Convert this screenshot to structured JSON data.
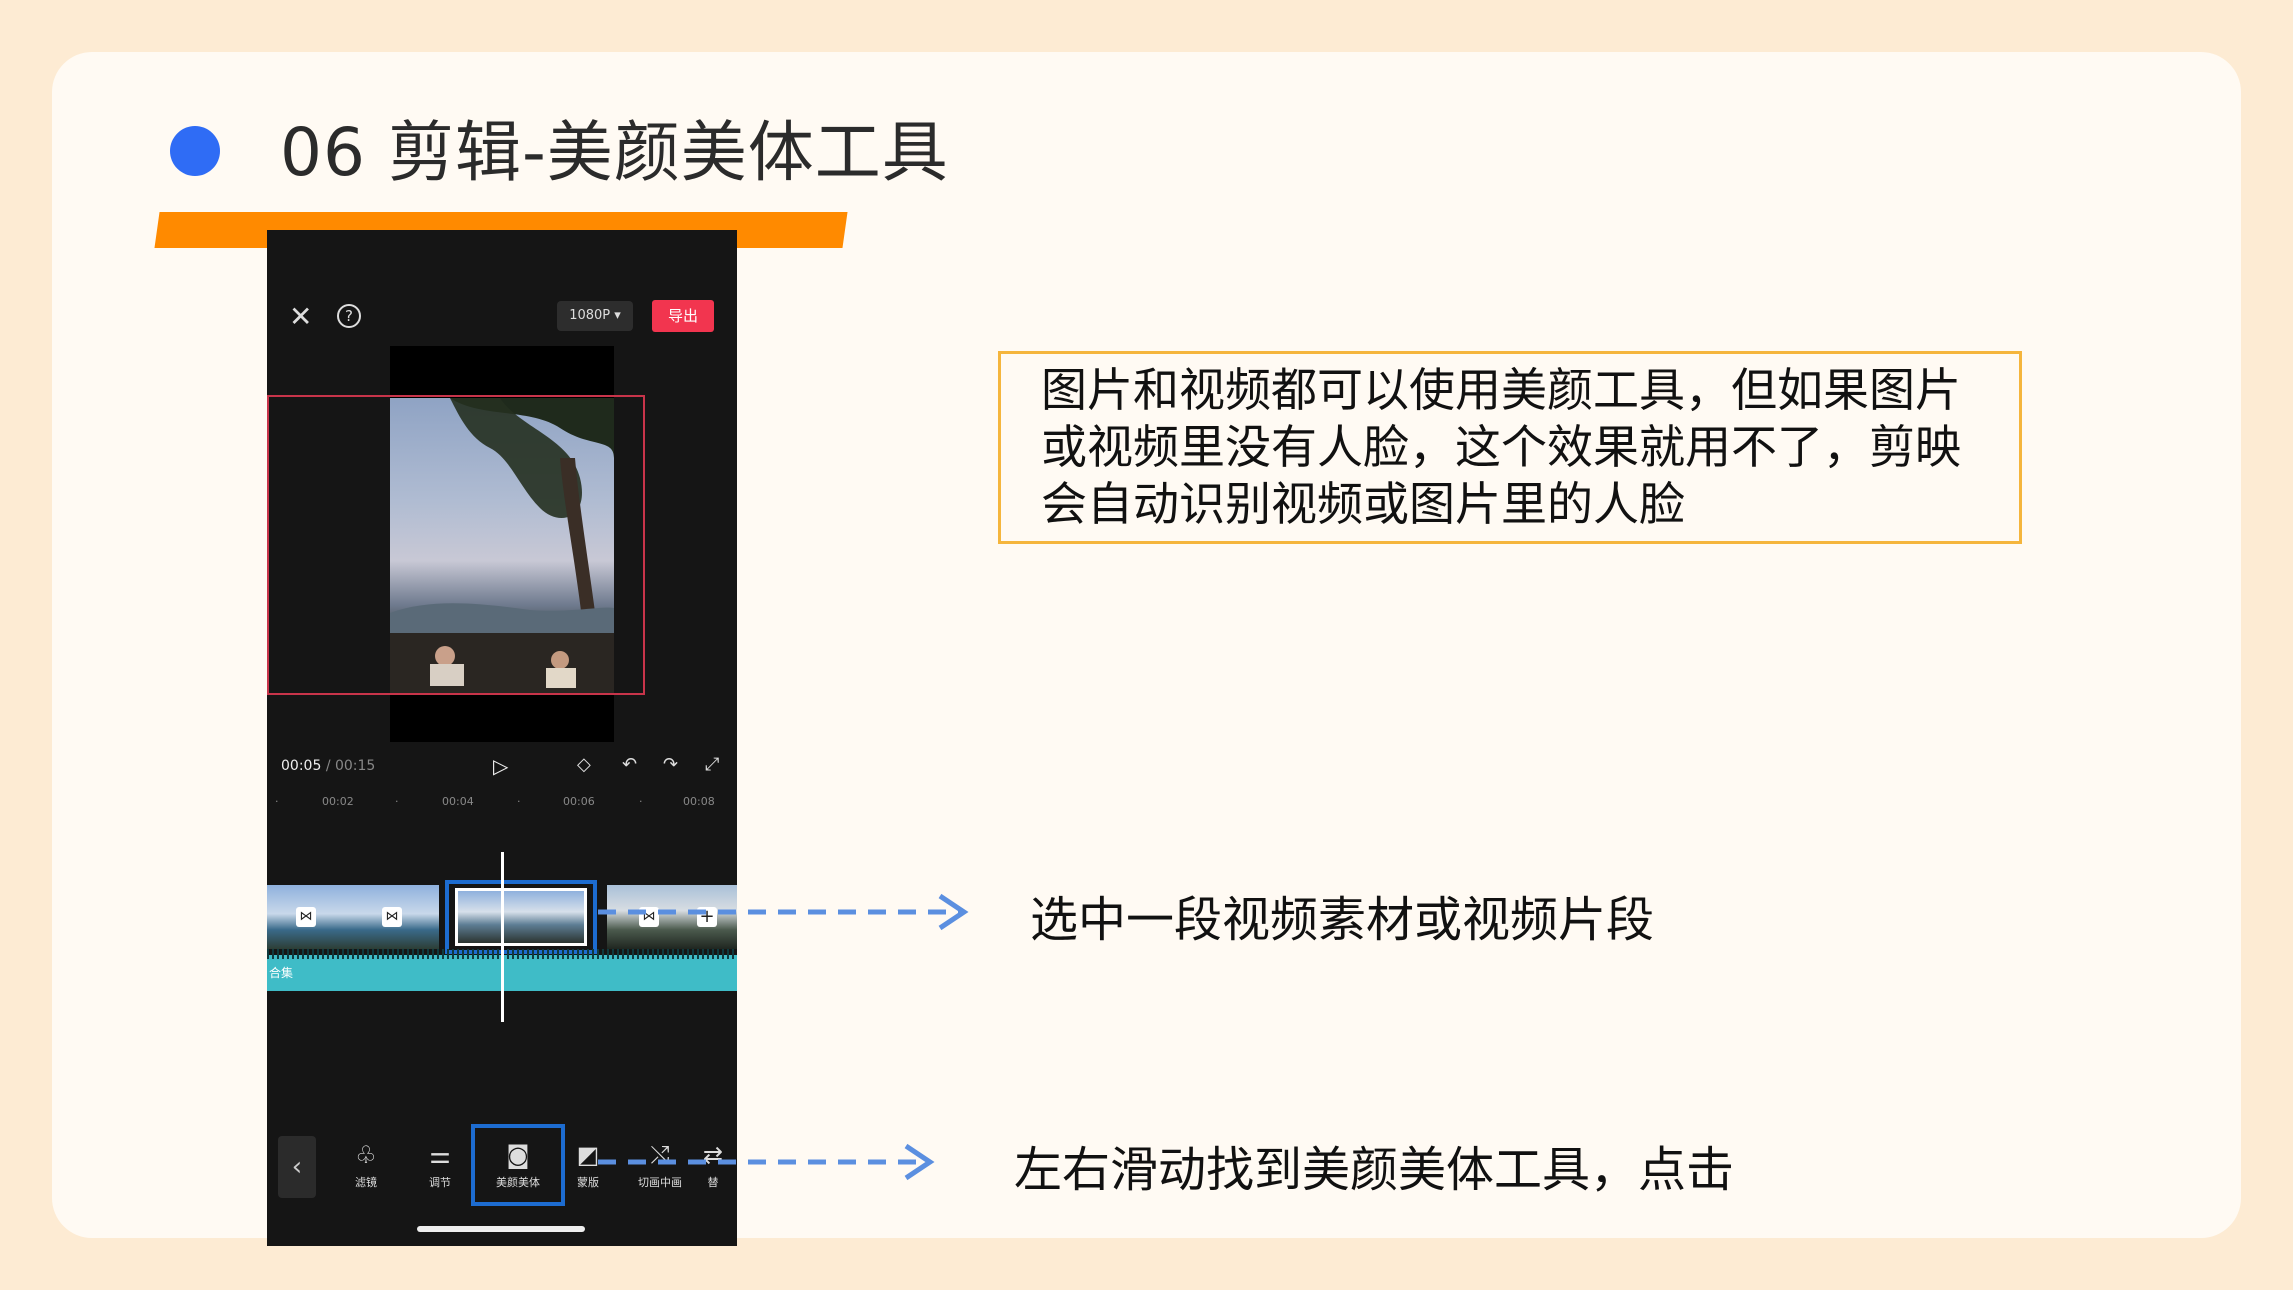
{
  "slide": {
    "title": "06 剪辑-美颜美体工具"
  },
  "phone": {
    "resolution": "1080P ▾",
    "export_label": "导出",
    "time_current": "00:05",
    "time_total": "/ 00:15",
    "ruler": [
      "00:02",
      "00:04",
      "00:06",
      "00:08"
    ],
    "audio_label": "合集",
    "tools": [
      {
        "icon": "filter-icon",
        "label": "滤镜"
      },
      {
        "icon": "adjust-icon",
        "label": "调节"
      },
      {
        "icon": "beauty-icon",
        "label": "美颜美体"
      },
      {
        "icon": "mask-icon",
        "label": "蒙版"
      },
      {
        "icon": "pip-icon",
        "label": "切画中画"
      },
      {
        "icon": "replace-icon",
        "label": "替"
      }
    ]
  },
  "notes": {
    "info": "图片和视频都可以使用美颜工具，但如果图片或视频里没有人脸，这个效果就用不了，剪映会自动识别视频或图片里的人脸",
    "step1": "选中一段视频素材或视频片段",
    "step2": "左右滑动找到美颜美体工具，点击"
  },
  "colors": {
    "accent_blue": "#2f6cf5",
    "orange_bar": "#ff8a00",
    "export_red": "#f2354f",
    "highlight_blue": "#1d6cd0",
    "arrow_blue": "#5b8fe0",
    "note_border": "#f5b53c"
  }
}
